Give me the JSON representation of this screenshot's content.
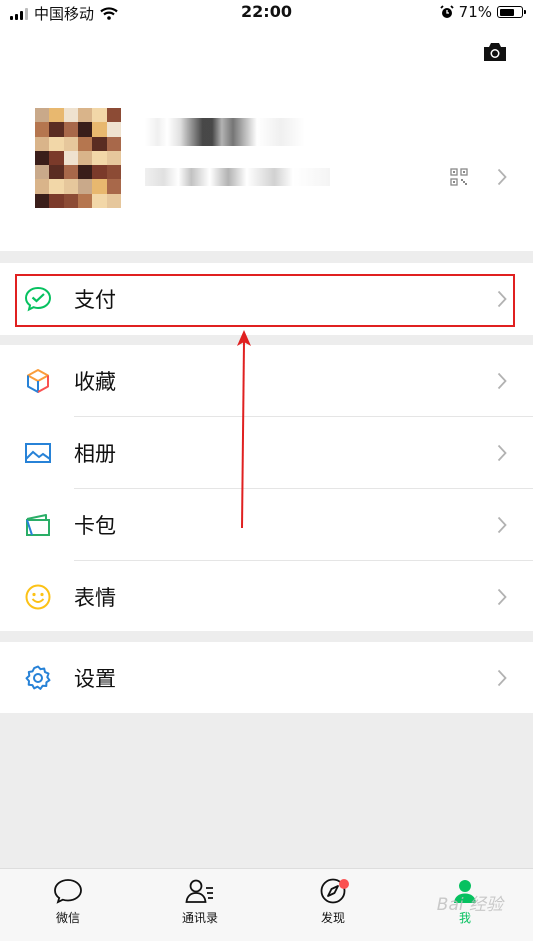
{
  "status_bar": {
    "carrier": "中国移动",
    "time": "22:00",
    "battery": "71%",
    "battery_level": 0.71
  },
  "menu": {
    "pay": "支付",
    "favorites": "收藏",
    "album": "相册",
    "cards": "卡包",
    "stickers": "表情",
    "settings": "设置"
  },
  "tabs": {
    "chats": "微信",
    "contacts": "通讯录",
    "discover": "发现",
    "me": "我"
  },
  "watermark": "Bai 经验",
  "colors": {
    "accent": "#07c160",
    "highlight": "#e02020",
    "badge": "#fa5151"
  },
  "icons": [
    "signal-icon",
    "wifi-icon",
    "alarm-icon",
    "battery-icon",
    "camera-icon",
    "qr-code-icon",
    "chevron-right-icon",
    "pay-icon",
    "favorites-icon",
    "album-icon",
    "cards-icon",
    "stickers-icon",
    "settings-icon",
    "chats-icon",
    "contacts-icon",
    "discover-icon",
    "me-icon"
  ]
}
